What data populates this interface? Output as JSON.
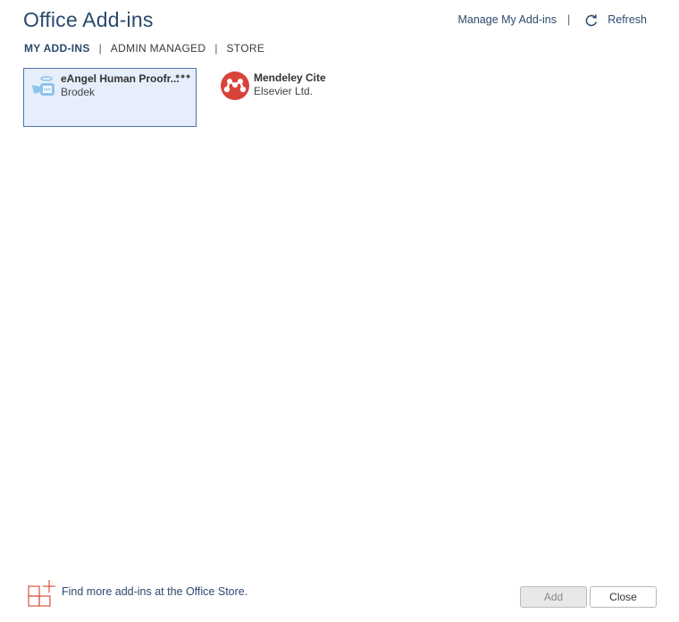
{
  "window": {
    "title": "Office Add-ins"
  },
  "topbar": {
    "manage_label": "Manage My Add-ins",
    "separator": "|",
    "refresh_label": "Refresh"
  },
  "tabs": [
    {
      "label": "MY ADD-INS",
      "active": true
    },
    {
      "label": "ADMIN MANAGED",
      "active": false
    },
    {
      "label": "STORE",
      "active": false
    }
  ],
  "tab_separator": "|",
  "addins": [
    {
      "name": "eAngel Human Proofr...",
      "publisher": "Brodek",
      "selected": true,
      "icon": "eangel-logo-icon",
      "more": "•••"
    },
    {
      "name": "Mendeley Cite",
      "publisher": "Elsevier Ltd.",
      "selected": false,
      "icon": "mendeley-logo-icon"
    }
  ],
  "footer": {
    "store_text": "Find more add-ins at the Office Store.",
    "add_label": "Add",
    "close_label": "Close"
  },
  "colors": {
    "accent": "#2b4a6e",
    "selection_bg": "#e6eefc",
    "selection_border": "#4e73b0",
    "mendeley_red": "#d9433b",
    "store_icon": "#d9543e"
  }
}
